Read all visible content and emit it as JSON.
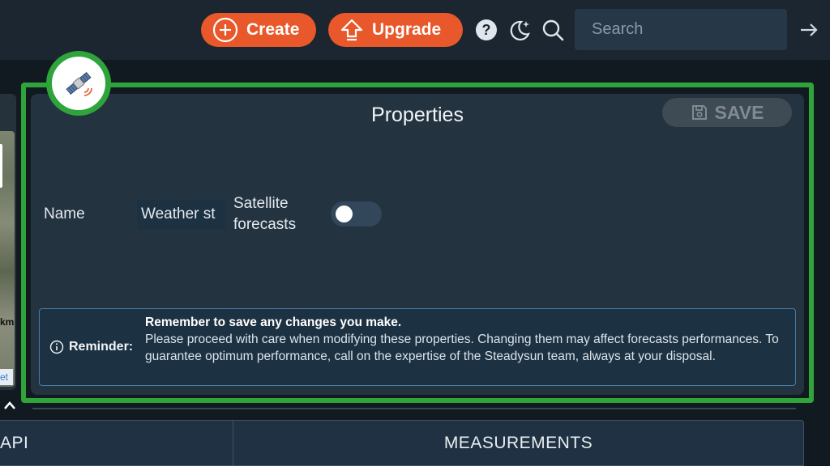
{
  "header": {
    "create_label": "Create",
    "upgrade_label": "Upgrade",
    "search_placeholder": "Search",
    "icons": [
      "plus-circle-icon",
      "upgrade-arrow-icon",
      "help-icon",
      "moon-icon",
      "search-icon",
      "logout-arrow-icon"
    ]
  },
  "map": {
    "scale_text": "km",
    "attribution_text": "et"
  },
  "properties": {
    "title": "Properties",
    "save_label": "SAVE",
    "badge_icon": "satellite-icon",
    "name_label": "Name",
    "name_value": "Weather st",
    "satellite_label": "Satellite forecasts",
    "satellite_forecasts_enabled": false,
    "reminder_label": "Reminder:",
    "reminder_headline": "Remember to save any changes you make.",
    "reminder_body": "Please proceed with care when modifying these properties. Changing them may affect forecasts performances. To guarantee optimum performance, call on the expertise of the Steadysun team, always at your disposal."
  },
  "tabs": [
    "API",
    "MEASUREMENTS"
  ],
  "colors": {
    "accent_orange": "#e8582a",
    "highlight_green": "#2ea43a",
    "panel": "#243340",
    "info_border": "#4a7aa6"
  }
}
